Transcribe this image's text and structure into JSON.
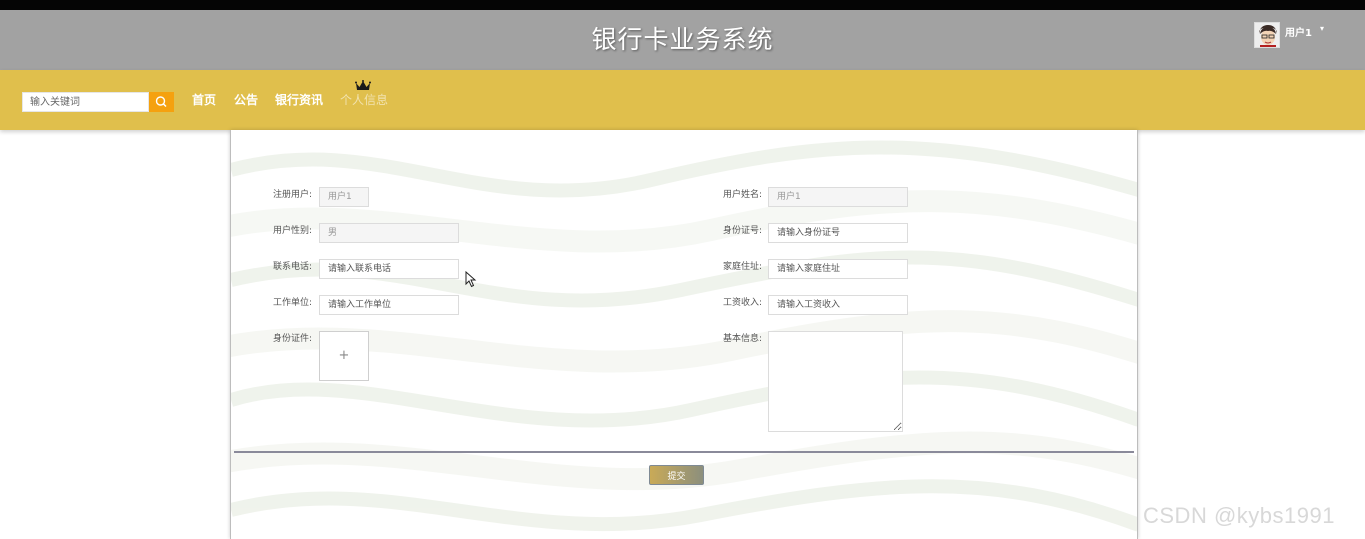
{
  "header": {
    "title": "银行卡业务系统",
    "user_name": "用户1",
    "caret": "▾"
  },
  "navbar": {
    "search_placeholder": "输入关键词",
    "items": [
      {
        "label": "首页"
      },
      {
        "label": "公告"
      },
      {
        "label": "银行资讯"
      },
      {
        "label": "个人信息"
      }
    ]
  },
  "form": {
    "left": {
      "register_user": {
        "label": "注册用户:",
        "placeholder": "用户1"
      },
      "gender": {
        "label": "用户性别:",
        "placeholder": "男"
      },
      "phone": {
        "label": "联系电话:",
        "placeholder": "请输入联系电话"
      },
      "work_unit": {
        "label": "工作单位:",
        "placeholder": "请输入工作单位"
      },
      "id_doc": {
        "label": "身份证件:",
        "upload_symbol": "+"
      }
    },
    "right": {
      "user_name": {
        "label": "用户姓名:",
        "placeholder": "用户1"
      },
      "id_number": {
        "label": "身份证号:",
        "placeholder": "请输入身份证号"
      },
      "address": {
        "label": "家庭住址:",
        "placeholder": "请输入家庭住址"
      },
      "income": {
        "label": "工资收入:",
        "placeholder": "请输入工资收入"
      },
      "basic_info": {
        "label": "基本信息:"
      }
    },
    "submit_label": "提交"
  },
  "watermark": "CSDN @kybs1991",
  "colors": {
    "header_bg": "#a2a2a2",
    "navbar_bg": "#e0bf4c",
    "search_button": "#f5a10f"
  }
}
